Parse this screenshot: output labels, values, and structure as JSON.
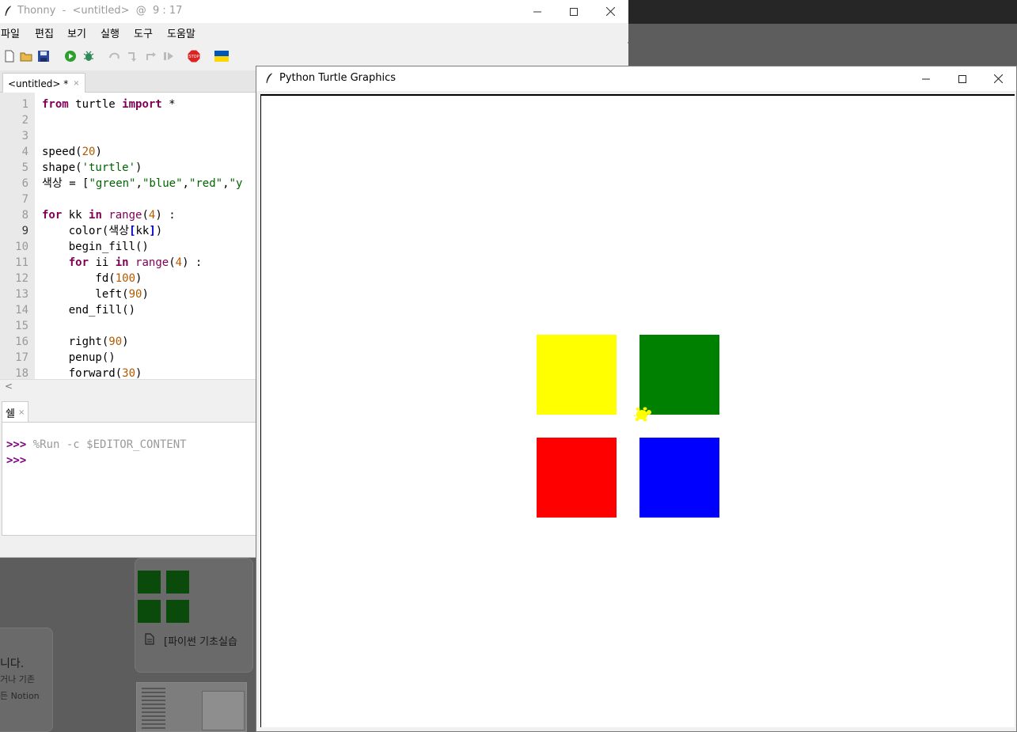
{
  "background": {
    "card_text": "[파이썬 기초실습",
    "side_text_1": "니다.",
    "side_text_2": "거나 기존",
    "side_text_3": "든 Notion"
  },
  "thonny": {
    "title": "Thonny  -  <untitled>  @  9 : 17",
    "menu": [
      "파일",
      "편집",
      "보기",
      "실행",
      "도구",
      "도움말"
    ],
    "editor_tab": "<untitled> *",
    "editor_tab_close": "×",
    "line_numbers": [
      "1",
      "2",
      "3",
      "4",
      "5",
      "6",
      "7",
      "8",
      "9",
      "10",
      "11",
      "12",
      "13",
      "14",
      "15",
      "16",
      "17",
      "18"
    ],
    "current_line": "9",
    "code": {
      "l1_kw1": "from",
      "l1_mod": " turtle ",
      "l1_kw2": "import",
      "l1_rest": " *",
      "l4_fn": "speed(",
      "l4_num": "20",
      "l4_end": ")",
      "l5_fn": "shape(",
      "l5_str": "'turtle'",
      "l5_end": ")",
      "l6_var": "색상 = [",
      "l6_s1": "\"green\"",
      "l6_c1": ",",
      "l6_s2": "\"blue\"",
      "l6_c2": ",",
      "l6_s3": "\"red\"",
      "l6_c3": ",",
      "l6_s4": "\"y",
      "l8_kw1": "for",
      "l8_var": " kk ",
      "l8_kw2": "in",
      "l8_sp": " ",
      "l8_bi": "range",
      "l8_p": "(",
      "l8_num": "4",
      "l8_end": ") :",
      "l9_a": "    color(색상",
      "l9_b1": "[",
      "l9_mid": "kk",
      "l9_b2": "]",
      "l9_end": ")",
      "l10": "    begin_fill()",
      "l11_ind": "    ",
      "l11_kw1": "for",
      "l11_var": " ii ",
      "l11_kw2": "in",
      "l11_sp": " ",
      "l11_bi": "range",
      "l11_p": "(",
      "l11_num": "4",
      "l11_end": ") :",
      "l12_a": "        fd(",
      "l12_num": "100",
      "l12_end": ")",
      "l13_a": "        left(",
      "l13_num": "90",
      "l13_end": ")",
      "l14": "    end_fill()",
      "l16_a": "    right(",
      "l16_num": "90",
      "l16_end": ")",
      "l17": "    penup()",
      "l18_a": "    forward(",
      "l18_num": "30",
      "l18_end": ")"
    },
    "shell_tab": "쉘",
    "shell_tab_close": "×",
    "shell_prompt": ">>>",
    "shell_command": " %Run -c $EDITOR_CONTENT"
  },
  "turtle": {
    "title": "Python Turtle Graphics",
    "colors": {
      "yellow": "#ffff00",
      "green": "#008000",
      "red": "#ff0000",
      "blue": "#0000ff"
    }
  }
}
